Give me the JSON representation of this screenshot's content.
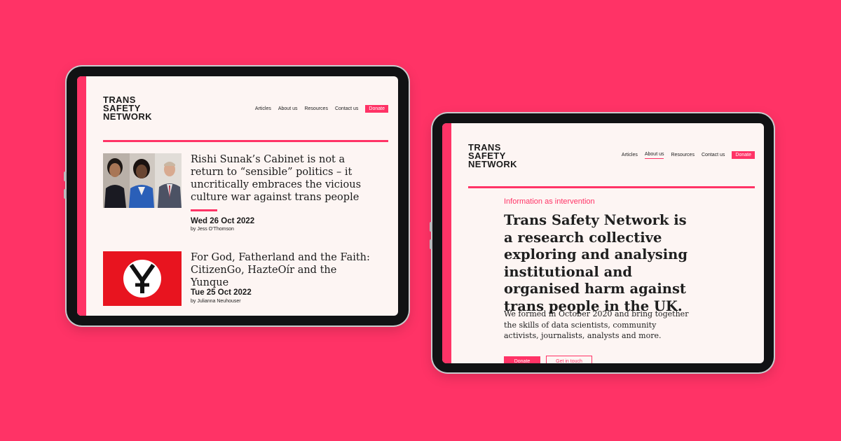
{
  "brand": {
    "logo_lines": [
      "TRANS",
      "SAFETY",
      "NETWORK"
    ],
    "accent_color": "#ff3366",
    "page_bg": "#fdf5f3"
  },
  "nav": {
    "articles": "Articles",
    "about": "About us",
    "resources": "Resources",
    "contact": "Contact us",
    "donate": "Donate"
  },
  "left_tablet": {
    "active_nav": "none",
    "articles": [
      {
        "title": "Rishi Sunak’s Cabinet is not a return to “sensible” politics – it uncritically embraces the vicious culture war against trans people",
        "date": "Wed 26 Oct 2022",
        "byline": "by Jess O’Thomson",
        "thumb": "portrait-photo"
      },
      {
        "title": "For God, Fatherland and the Faith: CitizenGo, HazteOír and the Yunque",
        "date": "Tue 25 Oct 2022",
        "byline": "by Julianna Neuhouser",
        "thumb": "yunque-symbol"
      }
    ]
  },
  "right_tablet": {
    "active_nav": "About us",
    "eyebrow": "Information as intervention",
    "lead": "Trans Safety Network is a research collective exploring and analysing institutional and organised harm against trans people in the UK.",
    "body": "We formed in October 2020 and bring together the skills of data scientists, community activists, journalists, analysts and more.",
    "buttons": {
      "donate": "Donate",
      "contact": "Get in touch"
    }
  }
}
